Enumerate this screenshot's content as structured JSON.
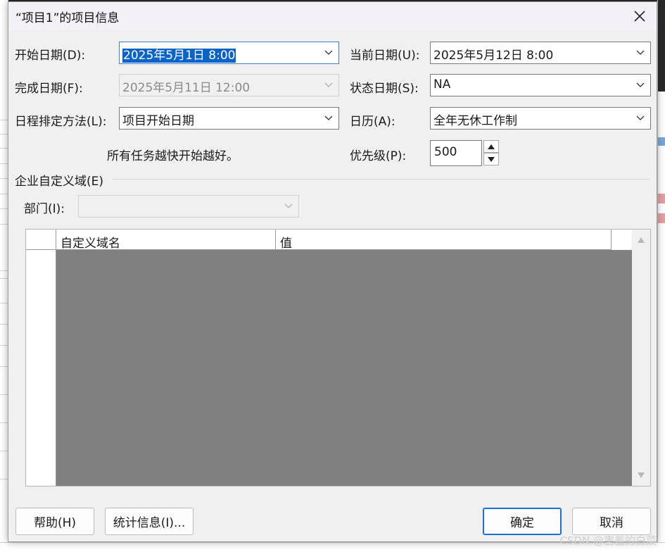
{
  "dialog": {
    "title": "“项目1”的项目信息",
    "close_icon": "close-icon"
  },
  "fields": {
    "start_date": {
      "label": "开始日期(D):",
      "value": "2025年5月1日 8:00"
    },
    "finish_date": {
      "label": "完成日期(F):",
      "value": "2025年5月11日 12:00"
    },
    "schedule_from": {
      "label": "日程排定方法(L):",
      "value": "项目开始日期"
    },
    "schedule_hint": "所有任务越快开始越好。",
    "current_date": {
      "label": "当前日期(U):",
      "value": "2025年5月12日 8:00"
    },
    "status_date": {
      "label": "状态日期(S):",
      "value": "NA"
    },
    "calendar": {
      "label": "日历(A):",
      "value": "全年无休工作制"
    },
    "priority": {
      "label": "优先级(P):",
      "value": "500"
    }
  },
  "enterprise": {
    "group_label": "企业自定义域(E)",
    "department_label": "部门(I):",
    "department_value": "",
    "columns": [
      "自定义域名",
      "值"
    ]
  },
  "buttons": {
    "help": "帮助(H)",
    "stats": "统计信息(I)...",
    "ok": "确定",
    "cancel": "取消"
  },
  "watermark": "CSDN @害羞的白菜",
  "colors": {
    "selection": "#0a64c8",
    "grid_body": "#808080",
    "primary_border": "#1a6fd1"
  }
}
